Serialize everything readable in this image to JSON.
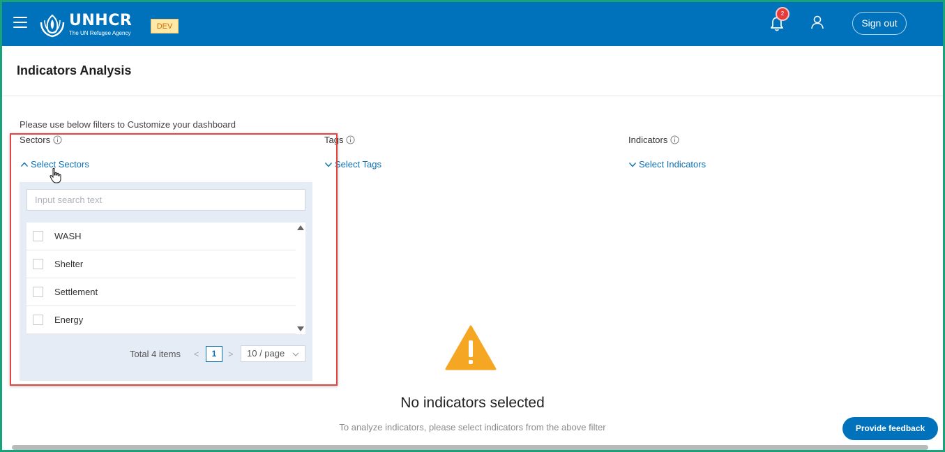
{
  "header": {
    "logo_name": "UNHCR",
    "logo_sub": "The UN Refugee Agency",
    "env_badge": "DEV",
    "notification_count": "2",
    "signout_label": "Sign out",
    "brand_color": "#0072bc"
  },
  "page": {
    "title": "Indicators Analysis",
    "hint": "Please use below filters to Customize your dashboard"
  },
  "filters": {
    "sectors": {
      "label": "Sectors",
      "select_label": "Select Sectors",
      "expanded": true
    },
    "tags": {
      "label": "Tags",
      "select_label": "Select Tags",
      "expanded": false
    },
    "indicators": {
      "label": "Indicators",
      "select_label": "Select Indicators",
      "expanded": false
    }
  },
  "sectors_dropdown": {
    "search_placeholder": "Input search text",
    "items": [
      {
        "label": "WASH",
        "checked": false
      },
      {
        "label": "Shelter",
        "checked": false
      },
      {
        "label": "Settlement",
        "checked": false
      },
      {
        "label": "Energy",
        "checked": false
      }
    ],
    "total": "Total 4 items",
    "current_page": "1",
    "page_size": "10 / page"
  },
  "empty_state": {
    "title": "No indicators selected",
    "subtitle": "To analyze indicators, please select indicators from the above filter",
    "warning_color": "#f5a623"
  },
  "feedback_label": "Provide feedback",
  "icons": {
    "menu": "hamburger-icon",
    "notifications": "bell-icon",
    "user": "user-icon",
    "info": "info-icon",
    "warning": "warning-icon"
  }
}
